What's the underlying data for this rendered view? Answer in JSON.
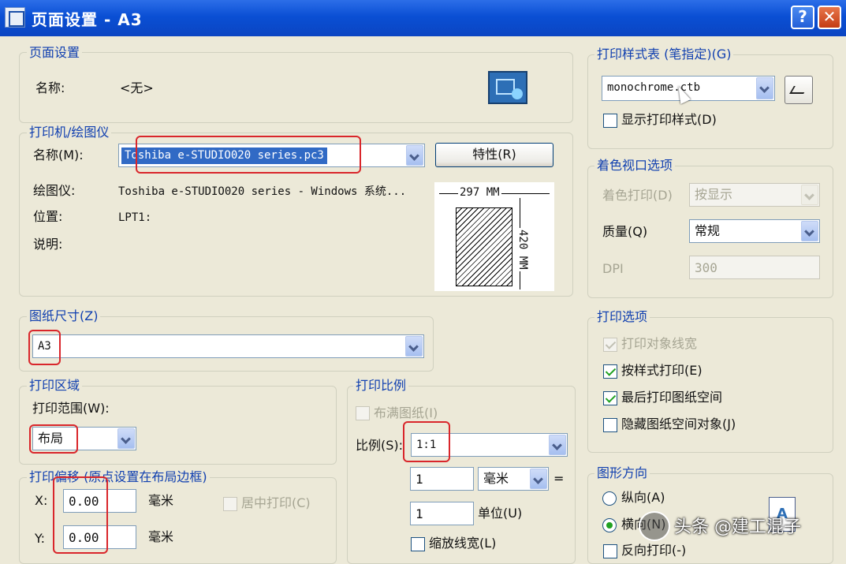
{
  "window": {
    "title": "页面设置 - A3",
    "help_label": "?",
    "close_label": "✕"
  },
  "page_setup": {
    "legend": "页面设置",
    "name_label": "名称:",
    "name_value": "<无>"
  },
  "printer": {
    "legend": "打印机/绘图仪",
    "name_label": "名称(M):",
    "name_value": "Toshiba e-STUDIO020 series.pc3",
    "properties_label": "特性(R)",
    "plotter_label": "绘图仪:",
    "plotter_value": "Toshiba e-STUDIO020 series - Windows 系统...",
    "location_label": "位置:",
    "location_value": "LPT1:",
    "description_label": "说明:"
  },
  "paper_preview": {
    "width_label": "297 MM",
    "height_label": "420 MM"
  },
  "paper_size": {
    "legend": "图纸尺寸(Z)",
    "value": "A3"
  },
  "print_area": {
    "legend": "打印区域",
    "range_label": "打印范围(W):",
    "range_value": "布局"
  },
  "print_offset": {
    "legend": "打印偏移 (原点设置在布局边框)",
    "x_label": "X:",
    "x_value": "0.00",
    "x_unit": "毫米",
    "y_label": "Y:",
    "y_value": "0.00",
    "y_unit": "毫米",
    "center_label": "居中打印(C)"
  },
  "print_scale": {
    "legend": "打印比例",
    "fit_label": "布满图纸(I)",
    "scale_label": "比例(S):",
    "scale_value": "1:1",
    "num_value": "1",
    "unit_value": "毫米",
    "equals": "=",
    "den_value": "1",
    "den_unit": "单位(U)",
    "lineweights_label": "缩放线宽(L)"
  },
  "plot_style": {
    "legend": "打印样式表 (笔指定)(G)",
    "table_value": "monochrome.ctb",
    "display_label": "显示打印样式(D)"
  },
  "shaded_viewport": {
    "legend": "着色视口选项",
    "shade_label": "着色打印(D)",
    "shade_value": "按显示",
    "quality_label": "质量(Q)",
    "quality_value": "常规",
    "dpi_label": "DPI",
    "dpi_value": "300"
  },
  "plot_options": {
    "legend": "打印选项",
    "items": [
      {
        "label": "打印对象线宽",
        "checked": true,
        "disabled": true
      },
      {
        "label": "按样式打印(E)",
        "checked": true,
        "disabled": false
      },
      {
        "label": "最后打印图纸空间",
        "checked": true,
        "disabled": false
      },
      {
        "label": "隐藏图纸空间对象(J)",
        "checked": false,
        "disabled": false
      }
    ]
  },
  "orientation": {
    "legend": "图形方向",
    "portrait_label": "纵向(A)",
    "landscape_label": "横向(N)",
    "upside_down_label": "反向打印(-)"
  },
  "watermark": {
    "text": "头条 @建工混子"
  },
  "colors": {
    "highlight": "#d9262b",
    "legend": "#1140b0"
  }
}
